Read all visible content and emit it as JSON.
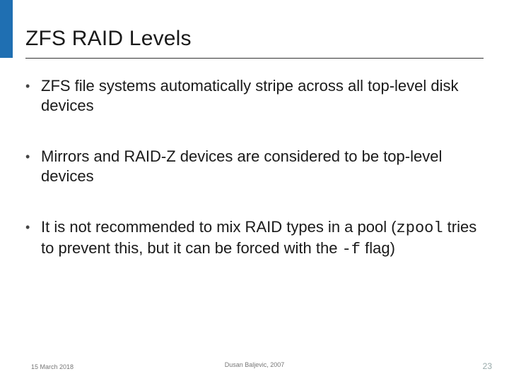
{
  "title": "ZFS RAID Levels",
  "bullets": [
    {
      "pre": "ZFS file systems automatically stripe across all top-level disk devices",
      "code1": "",
      "mid": "",
      "code2": "",
      "post": ""
    },
    {
      "pre": "Mirrors and RAID-Z devices are considered to be top-level devices",
      "code1": "",
      "mid": "",
      "code2": "",
      "post": ""
    },
    {
      "pre": "It is not recommended to mix RAID types in a pool (",
      "code1": "zpool",
      "mid": " tries to prevent this, but it can be forced with the ",
      "code2": "-f",
      "post": " flag)"
    }
  ],
  "footer": {
    "left": "15 March 2018",
    "center": "Dusan Baljevic, 2007",
    "right": "23"
  }
}
